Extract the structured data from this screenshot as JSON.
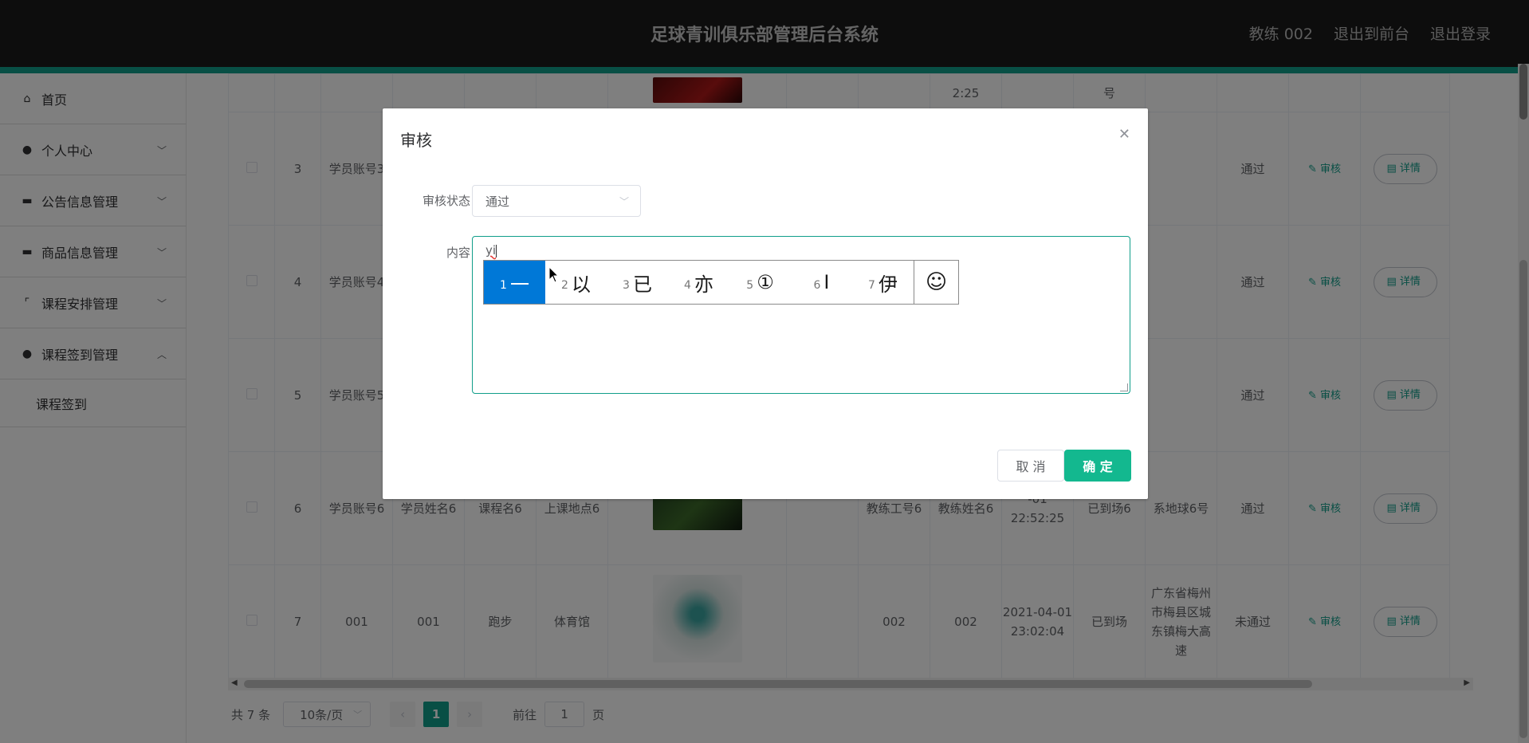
{
  "header": {
    "title": "足球青训俱乐部管理后台系统",
    "user": "教练 002",
    "to_front": "退出到前台",
    "logout": "退出登录"
  },
  "sidebar": {
    "items": [
      {
        "label": "首页",
        "icon": "home-icon"
      },
      {
        "label": "个人中心",
        "icon": "user-icon"
      },
      {
        "label": "公告信息管理",
        "icon": "monitor-icon"
      },
      {
        "label": "商品信息管理",
        "icon": "monitor-icon"
      },
      {
        "label": "课程安排管理",
        "icon": "crop-icon"
      },
      {
        "label": "课程签到管理",
        "icon": "user-icon"
      }
    ],
    "sub_item": "课程签到"
  },
  "table": {
    "row0": {
      "time": "2:25",
      "addr": "号"
    },
    "rows": [
      {
        "idx": "3",
        "account": "学员账号3",
        "status": "通过",
        "audit": "审核",
        "detail": "详情"
      },
      {
        "idx": "4",
        "account": "学员账号4",
        "status": "通过",
        "audit": "审核",
        "detail": "详情"
      },
      {
        "idx": "5",
        "account": "学员账号5",
        "status": "通过",
        "audit": "审核",
        "detail": "详情"
      },
      {
        "idx": "6",
        "account": "学员账号6",
        "name": "学员姓名6",
        "course": "课程名6",
        "place": "上课地点6",
        "coach": "教练工号6",
        "coach_name": "教练姓名6",
        "time": "-01 22:52:25",
        "arrive": "已到场6",
        "addr": "系地球6号",
        "status": "通过",
        "audit": "审核",
        "detail": "详情"
      },
      {
        "idx": "7",
        "account": "001",
        "name": "001",
        "course": "跑步",
        "place": "体育馆",
        "coach": "002",
        "coach_name": "002",
        "time": "2021-04-01 23:02:04",
        "arrive": "已到场",
        "addr": "广东省梅州市梅县区城东镇梅大高速",
        "status": "未通过",
        "audit": "审核",
        "detail": "详情"
      }
    ]
  },
  "pager": {
    "total": "共 7 条",
    "page_size": "10条/页",
    "current": "1",
    "goto_label": "前往",
    "goto_value": "1",
    "page_unit": "页"
  },
  "dialog": {
    "title": "审核",
    "status_label": "审核状态",
    "status_value": "通过",
    "content_label": "内容",
    "typed": "yi",
    "cancel": "取 消",
    "confirm": "确 定"
  },
  "ime": {
    "candidates": [
      {
        "n": "1",
        "c": "一"
      },
      {
        "n": "2",
        "c": "以"
      },
      {
        "n": "3",
        "c": "已"
      },
      {
        "n": "4",
        "c": "亦"
      },
      {
        "n": "5",
        "c": "①"
      },
      {
        "n": "6",
        "c": "Ⅰ"
      },
      {
        "n": "7",
        "c": "伊"
      }
    ],
    "emoji": "☺"
  },
  "colors": {
    "accent": "#13b88f",
    "header_bg": "#1a1a1a",
    "ime_active": "#0078d7"
  }
}
